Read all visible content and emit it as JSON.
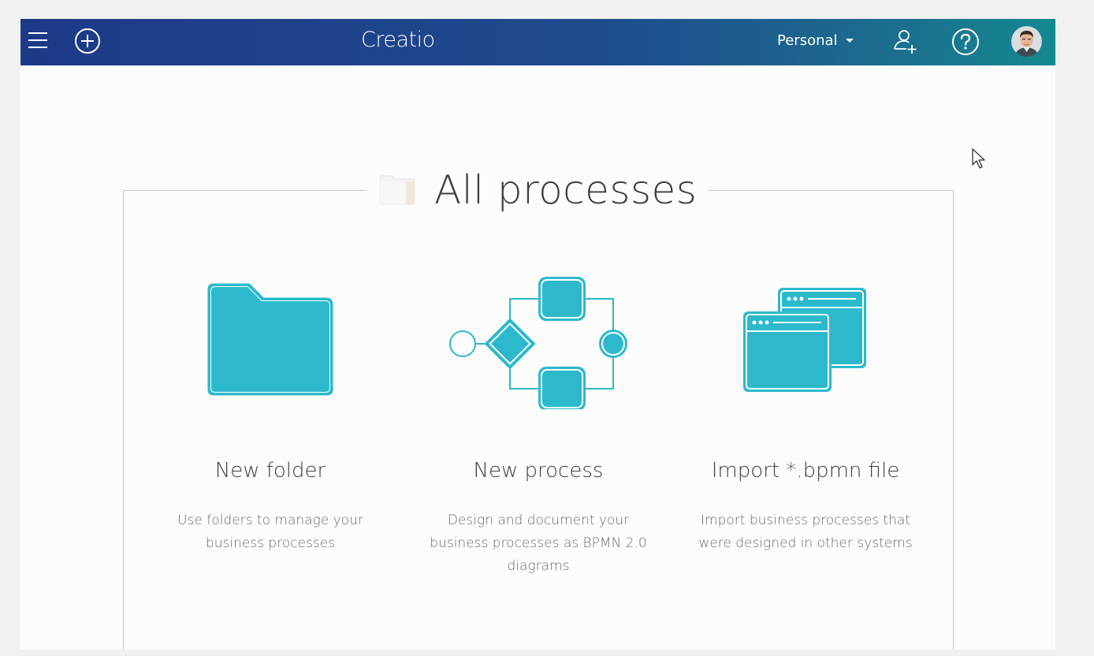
{
  "header": {
    "logo_text": "Creatio",
    "workspace_label": "Personal",
    "icons": [
      "menu-icon",
      "add-icon",
      "invite-user-icon",
      "help-icon",
      "avatar"
    ]
  },
  "main": {
    "title": "All processes",
    "options": [
      {
        "icon": "folder-icon",
        "title": "New folder",
        "description": "Use folders to manage your business processes"
      },
      {
        "icon": "bpmn-diagram-icon",
        "title": "New process",
        "description": "Design and document your business processes as BPMN 2.0 diagrams"
      },
      {
        "icon": "windows-icon",
        "title": "Import *.bpmn file",
        "description": "Import business processes that were designed in other systems"
      }
    ]
  },
  "colors": {
    "accent": "#2cb9cc",
    "header_start": "#1d3a87",
    "header_end": "#148990"
  }
}
